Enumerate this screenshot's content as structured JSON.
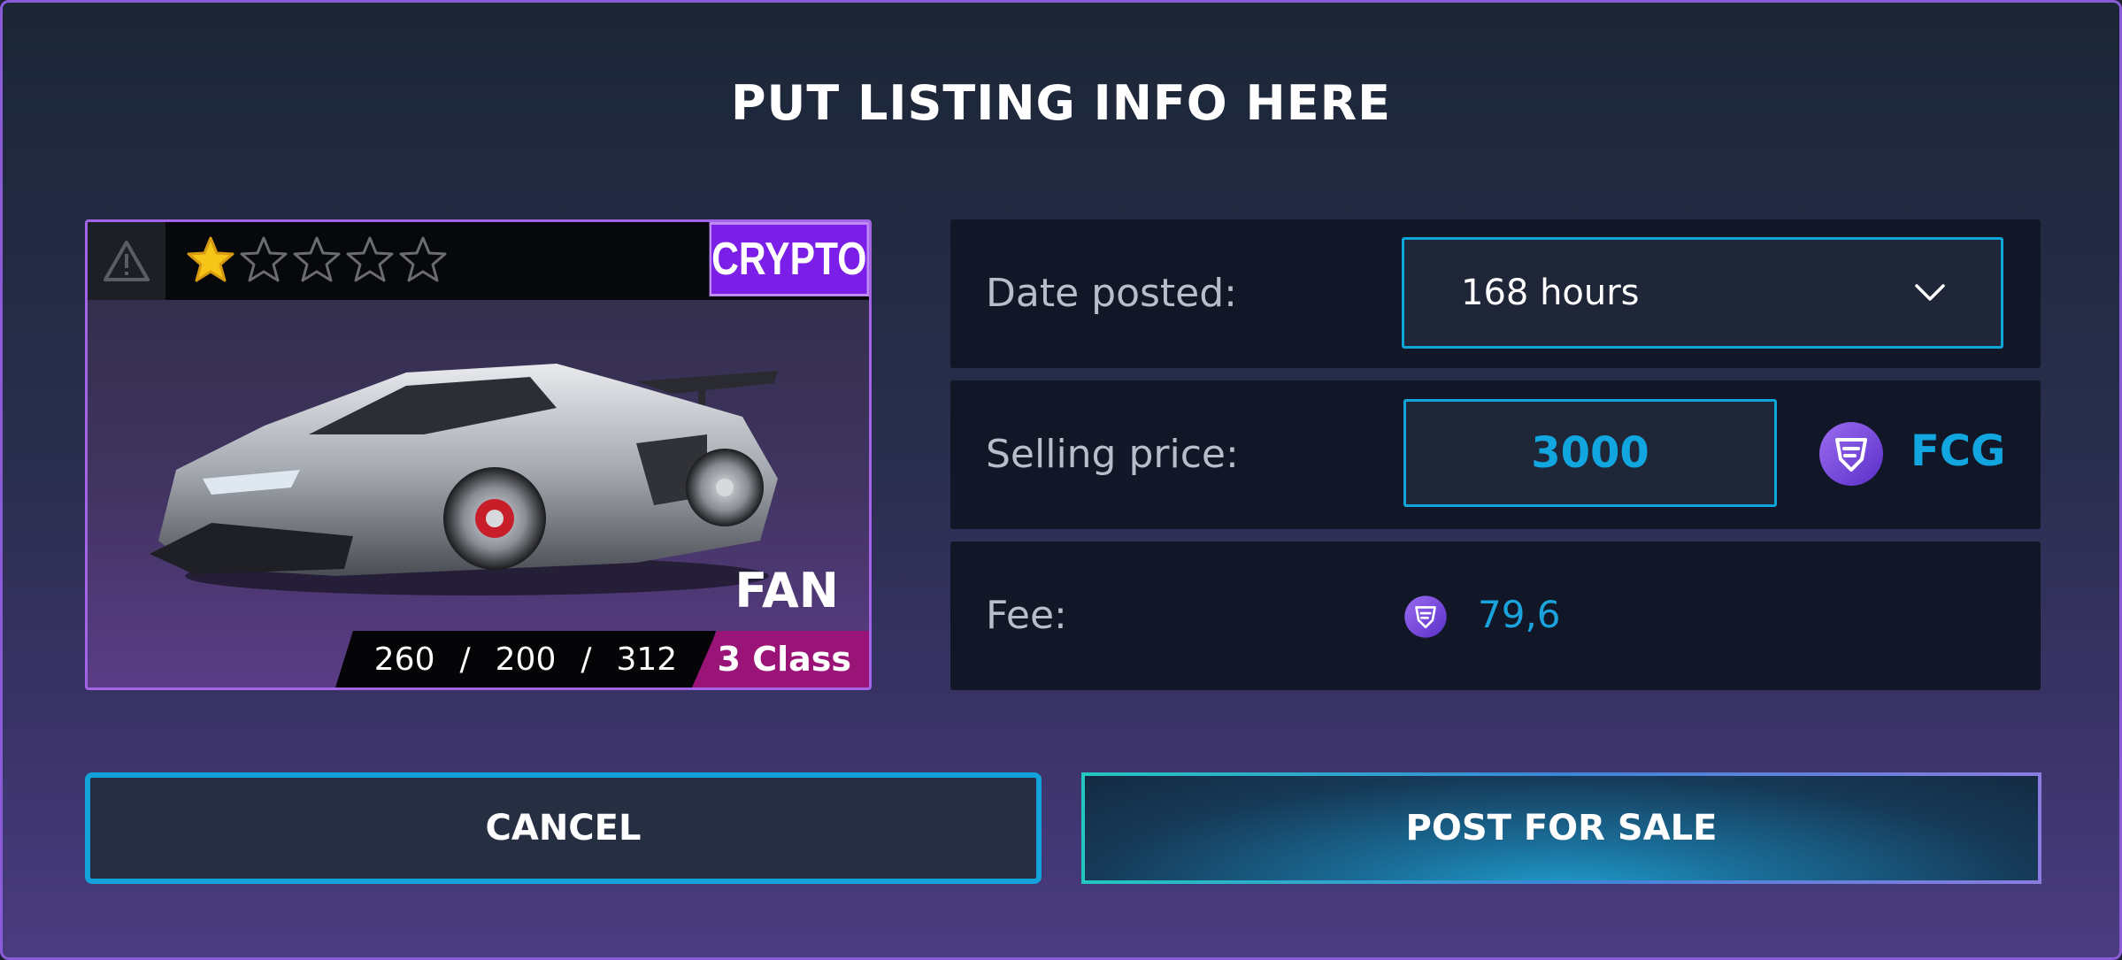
{
  "dialog": {
    "title": "PUT LISTING INFO HERE"
  },
  "car_card": {
    "rating": 1,
    "rating_max": 5,
    "badge": "CRYPTO",
    "name": "FAN",
    "stats": [
      "260",
      "200",
      "312"
    ],
    "stats_separator": "/",
    "class_label": "3 Class",
    "colors": {
      "badge": "#7a1ee8",
      "class_badge": "#9a1478",
      "star_filled": "#f5c518"
    }
  },
  "form": {
    "date_posted": {
      "label": "Date posted:",
      "value": "168 hours"
    },
    "selling_price": {
      "label": "Selling price:",
      "value": "3000",
      "currency": "FCG"
    },
    "fee": {
      "label": "Fee:",
      "value": "79,6"
    }
  },
  "buttons": {
    "cancel": "CANCEL",
    "post": "POST FOR SALE"
  },
  "colors": {
    "accent": "#12a6e0",
    "card_border": "#a464e8"
  }
}
